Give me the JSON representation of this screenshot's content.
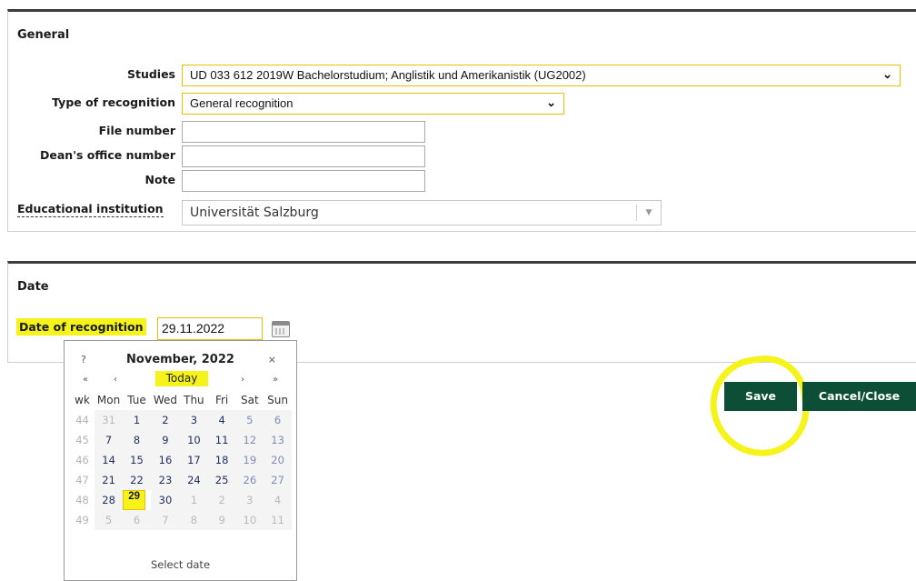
{
  "general": {
    "title": "General",
    "studies_label": "Studies",
    "studies_value": "UD 033 612 2019W Bachelorstudium; Anglistik und Amerikanistik (UG2002)",
    "type_label": "Type of recognition",
    "type_value": "General recognition",
    "file_number_label": "File number",
    "file_number_value": "",
    "deans_office_label": "Dean's office number",
    "deans_office_value": "",
    "note_label": "Note",
    "note_value": "",
    "institution_label": "Educational institution",
    "institution_value": "Universität Salzburg"
  },
  "date": {
    "title": "Date",
    "recognition_label": "Date of recognition",
    "recognition_value": "29.11.2022"
  },
  "calendar": {
    "help": "?",
    "title": "November, 2022",
    "close": "×",
    "prev_year": "«",
    "prev_month": "‹",
    "today": "Today",
    "next_month": "›",
    "next_year": "»",
    "headers": [
      "wk",
      "Mon",
      "Tue",
      "Wed",
      "Thu",
      "Fri",
      "Sat",
      "Sun"
    ],
    "weeks": [
      {
        "wk": "44",
        "days": [
          "31",
          "1",
          "2",
          "3",
          "4",
          "5",
          "6"
        ]
      },
      {
        "wk": "45",
        "days": [
          "7",
          "8",
          "9",
          "10",
          "11",
          "12",
          "13"
        ]
      },
      {
        "wk": "46",
        "days": [
          "14",
          "15",
          "16",
          "17",
          "18",
          "19",
          "20"
        ]
      },
      {
        "wk": "47",
        "days": [
          "21",
          "22",
          "23",
          "24",
          "25",
          "26",
          "27"
        ]
      },
      {
        "wk": "48",
        "days": [
          "28",
          "29",
          "30",
          "1",
          "2",
          "3",
          "4"
        ]
      },
      {
        "wk": "49",
        "days": [
          "5",
          "6",
          "7",
          "8",
          "9",
          "10",
          "11"
        ]
      }
    ],
    "selected_day": "29",
    "footer": "Select date"
  },
  "buttons": {
    "save": "Save",
    "cancel": "Cancel/Close"
  },
  "colors": {
    "button_bg": "#0d4f36",
    "highlight": "#f5f31a",
    "field_border": "#e8c200"
  }
}
